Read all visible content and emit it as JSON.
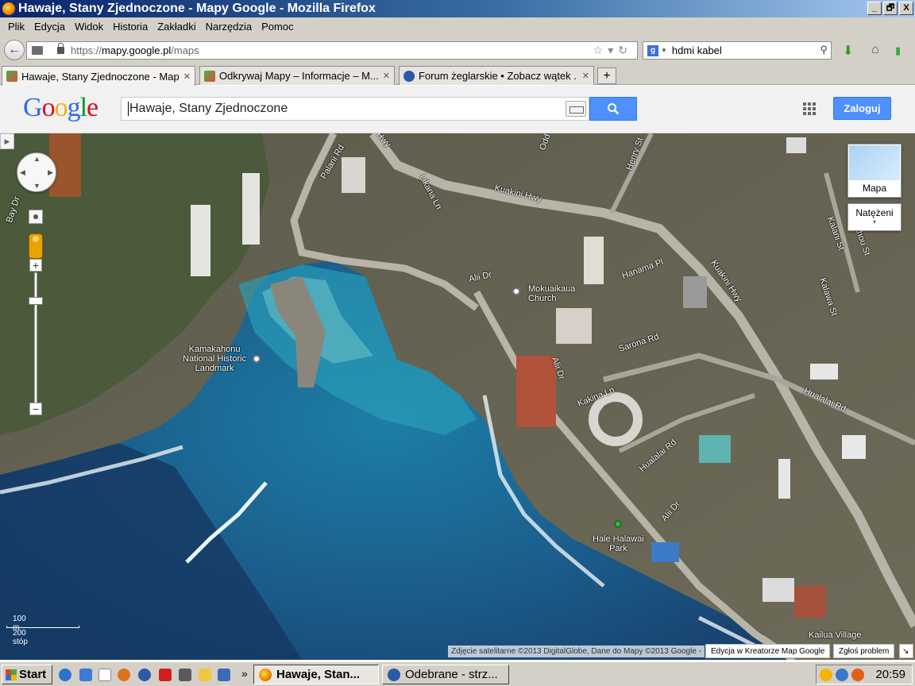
{
  "window": {
    "title": "Hawaje, Stany Zjednoczone - Mapy Google - Mozilla Firefox",
    "buttons": [
      "_",
      "🗗",
      "X"
    ]
  },
  "menu": [
    "Plik",
    "Edycja",
    "Widok",
    "Historia",
    "Zakładki",
    "Narzędzia",
    "Pomoc"
  ],
  "navbar": {
    "url_prefix": "https://",
    "url_domain": "mapy.google.pl",
    "url_path": "/maps",
    "search_value": "hdmi kabel"
  },
  "tabs": [
    {
      "label": "Hawaje, Stany Zjednoczone - Map...",
      "close": "✕",
      "active": true
    },
    {
      "label": "Odkrywaj Mapy – Informacje – M...",
      "close": "✕",
      "active": false
    },
    {
      "label": "Forum żeglarskie • Zobacz wątek ...",
      "close": "✕",
      "active": false
    }
  ],
  "newtab_label": "+",
  "google": {
    "logo": [
      "G",
      "o",
      "o",
      "g",
      "l",
      "e"
    ],
    "logo_colors": [
      "#3369e8",
      "#d50f25",
      "#eeb211",
      "#3369e8",
      "#009925",
      "#d50f25"
    ],
    "query": "Hawaje, Stany Zjednoczone",
    "login": "Zaloguj"
  },
  "map": {
    "labels": {
      "kuakini_hwy_1": "Kuakini Hwy",
      "kuakini_hwy_2": "Kuakini Hwy",
      "palani_rd": "Palani Rd",
      "hwy_top": "Hwy",
      "likana_ln": "Likana Ln",
      "alii_dr_1": "Alii Dr",
      "alii_dr_2": "Alii Dr",
      "alii_dr_3": "Alii Dr",
      "mokuaikaua": "Mokuaikaua\nChurch",
      "hanama_pl": "Hanama Pl",
      "sarona_rd": "Sarona Rd",
      "kakina_ln": "Kakina Ln",
      "hualalai_rd_1": "Hualalai Rd",
      "hualalai_rd_2": "Hualalai Rd",
      "kamakahonu": "Kamakahonu\nNational Historic\nLandmark",
      "hale_halawai": "Hale Halawai\nPark",
      "kailua_village": "Kailua Village",
      "kalani_st": "Kalani St",
      "alahou_st": "Alahou St",
      "kalawa_st": "Kalawa St",
      "henry_st": "Henry St",
      "bay_dr": "Bay Dr",
      "odd": "Odd"
    },
    "map_type": "Mapa",
    "traffic": "Natężeni",
    "scale_metric": "100 m",
    "scale_imperial": "200 stóp",
    "attribution": "Zdjęcie satelitarne ©2013 DigitalGlobe, Dane do Mapy ©2013 Google -",
    "footer_links": [
      "Edycja w Kreatorze Map Google",
      "Zgłoś problem"
    ]
  },
  "taskbar": {
    "start": "Start",
    "tasks": [
      "Hawaje, Stan...",
      "Odebrane - strz..."
    ],
    "arrows": "»",
    "clock": "20:59"
  }
}
